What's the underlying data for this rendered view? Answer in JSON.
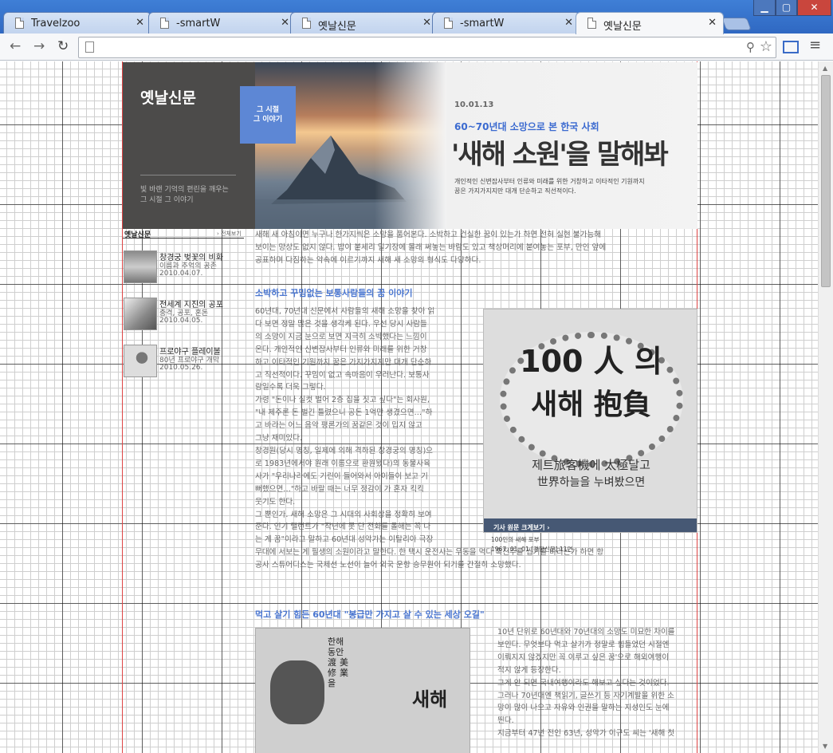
{
  "browser": {
    "tabs": [
      {
        "title": "Travelzoo"
      },
      {
        "title": "-smartW"
      },
      {
        "title": "옛날신문"
      },
      {
        "title": "-smartW"
      },
      {
        "title": "옛날신문"
      }
    ],
    "active_tab": 4
  },
  "hero": {
    "logo": "옛날신문",
    "tag_line1": "그 시절",
    "tag_line2": "그 이야기",
    "sub_line1": "빛 바랜 기억의 편린을 깨우는",
    "sub_line2": "그 시절 그 이야기",
    "date": "10.01.13",
    "kicker": "60~70년대 소망으로 본 한국 사회",
    "headline": "'새해 소원'을 말해봐",
    "desc_line1": "개인적인 신변잡사부터 인류와 미래를 위한 거창하고 이타적인 기원까지",
    "desc_line2": "꿈은 가지가지지만 대개 단순하고 직선적이다."
  },
  "sidebar": {
    "title": "옛날신문",
    "all_link": "› 전체보기",
    "items": [
      {
        "title": "창경궁 벚꽃의 비화",
        "sub": "이름과 추억의 공존",
        "date": "2010.04.07."
      },
      {
        "title": "전세계 지진의 공포",
        "sub": "충격, 공포, 혼돈",
        "date": "2010.04.05."
      },
      {
        "title": "프로야구 플레이볼",
        "sub": "80년 프로야구 개막",
        "date": "2010.05.26."
      }
    ]
  },
  "article": {
    "intro": [
      "새해 새 아침이면 누구나 한가지씩은 소망을 품어본다. 소박하고 건실한 꿈이 있는가 하면 전혀 실현 불가능해",
      "보이는 망상도 없지 않다. 밥이 붙세리 일기장에 몰래 써놓는 바람도 있고 책상머리에 붙여놓는 포부, 만인 앞에",
      "공표하며 다짐하는 약속에 이르기까지 새해 새 소망의 형식도 다양하다."
    ],
    "h1": "소박하고 꾸밈없는 보통사람들의 꿈 이야기",
    "p1": [
      "60년대, 70년대 신문에서 사람들의 새해 소망을 찾아 읽",
      "다 보면 정말 많은 것을 생각케 된다. 우선 당시 사람들",
      "의 소망이 지금 눈으로 보면 지극히 소박했다는 느낌이",
      "온다. 개인적인 신변잡사부터 인류와 미래를 위한 거창",
      "하고 이타적인 기원까지 꿈은 가지가지지만 대개 단순하",
      "고 직선적이다. 꾸밈이 없고 속마음이 우러난다. 보통사",
      "람일수록 더욱 그렇다.",
      "가령 \"돈이나 실컷 벌어 2층 집을 짓고 싶다\"는 회사원,",
      "\"내 제주론 돈 벌긴 틀렸으니 공돈 1억만 생겼으면…\"하",
      "고 바라는 어느 음악 평론가의 꿈같은 것이 밉지 않고",
      "그냥 재미있다.",
      "창경원(당시 명칭, 일제에 의해 격하된 창경궁의 명칭)으",
      "로 1983년에서야 원래 이름으로 환원됐다)의 동물사육",
      "사가 \"우리나라에도 기린이 들어와서 아이들이 보고 기",
      "뻐했으면…\"하고 바랄 때는 너무 정감이 가 혼자 킥킥",
      "웃기도 한다.",
      "그 뿐인가. 새해 소망은 그 시대의 사회상을 정확히 보여",
      "준다. 인기 탤런트가 \"작년에 못 단 전화를 올해는 꼭 나",
      "는 게 꿈\"이라고 말하고 60년대 성악가는 이탈리아 극장"
    ],
    "p1_full": [
      "무대에 서보는 게 필생의 소원이라고 말한다. 한 택시 운전사는 우동을 먹다 혹진주를 씹기를 바라는가 하면 항",
      "공사 스튜어디스는 국제선 노선이 늘어 외국 운항 승무원이 되기를 간절히 소망했다."
    ],
    "fig1": {
      "line1": "100 人 의",
      "line2": "새해 抱負",
      "line3": "제트旅客機에 太極달고",
      "line4": "世界하늘을 누벼봤으면",
      "bar": "기사 원문 크게보기 ›",
      "cap1": "100인의 새해 포부",
      "cap2": "1967. 01. 01 [경향신문] 11면"
    },
    "h2": "먹고 살기 힘든 60년대 \"봉급만 가지고 살 수 있는 세상 오길\"",
    "p2": [
      "10년 단위로 60년대와 70년대의 소망도 미묘한 차이를",
      "보인다. 무엇보다 먹고 살기가 정말로 힘들었던 시절엔",
      "이뤄지지 않겠지만 꼭 이루고 싶은 꿈'으로 해외여행이",
      "적지 않게 등장한다.",
      "그게 안 되면 국내여행이라도 해보고 싶다는 것이었다.",
      "그러나 70년대엔 책읽기, 글쓰기 등 자기계발을 위한 소",
      "망이 많이 나오고 자유와 인권을 말하는 지성인도 눈에",
      "띈다.",
      "지금부터 47년 전인 63년, 성악가 이규도 씨는 '새해 첫"
    ],
    "fig2": {
      "text": "새해",
      "col": "한해동안 渡美修業을"
    }
  }
}
